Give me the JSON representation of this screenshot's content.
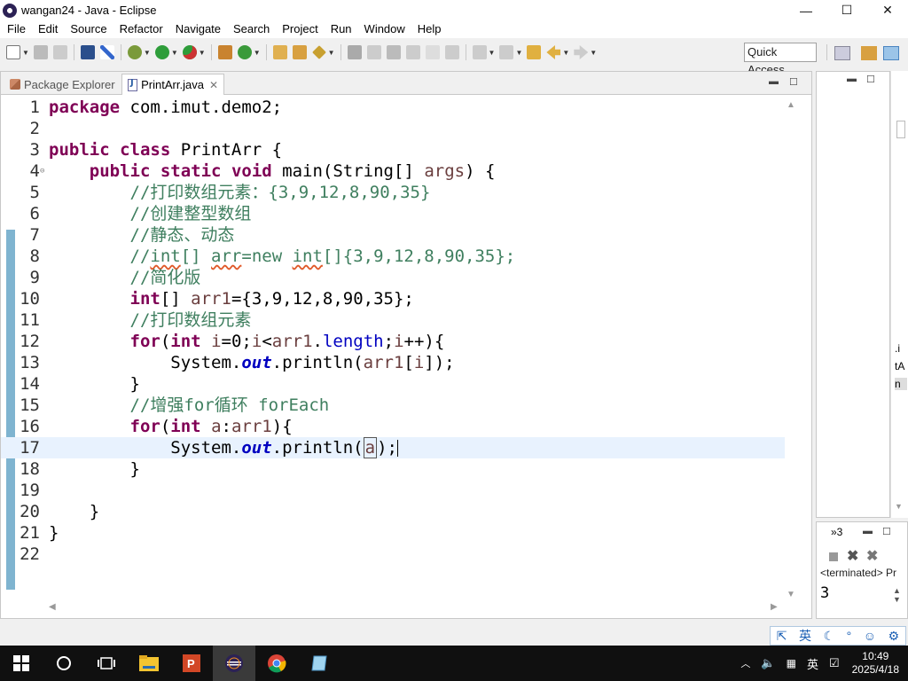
{
  "window": {
    "title": "wangan24 - Java - Eclipse",
    "controls": [
      "—",
      "☐",
      "✕"
    ]
  },
  "menu": [
    "File",
    "Edit",
    "Source",
    "Refactor",
    "Navigate",
    "Search",
    "Project",
    "Run",
    "Window",
    "Help"
  ],
  "toolbar": {
    "quick_access": "Quick Access"
  },
  "tabs": [
    {
      "label": "Package Explorer",
      "active": false
    },
    {
      "label": "PrintArr.java",
      "active": true,
      "close": "✕"
    }
  ],
  "editor": {
    "current_line": 17,
    "lines": [
      {
        "n": "1",
        "text": "package com.imut.demo2;"
      },
      {
        "n": "2",
        "text": ""
      },
      {
        "n": "3",
        "text": "public class PrintArr {"
      },
      {
        "n": "4",
        "text": "    public static void main(String[] args) {"
      },
      {
        "n": "5",
        "text": "        //打印数组元素：{3,9,12,8,90,35}"
      },
      {
        "n": "6",
        "text": "        //创建整型数组"
      },
      {
        "n": "7",
        "text": "        //静态、动态"
      },
      {
        "n": "8",
        "text": "        //int[] arr=new int[]{3,9,12,8,90,35};"
      },
      {
        "n": "9",
        "text": "        //简化版"
      },
      {
        "n": "10",
        "text": "        int[] arr1={3,9,12,8,90,35};"
      },
      {
        "n": "11",
        "text": "        //打印数组元素"
      },
      {
        "n": "12",
        "text": "        for(int i=0;i<arr1.length;i++){"
      },
      {
        "n": "13",
        "text": "            System.out.println(arr1[i]);"
      },
      {
        "n": "14",
        "text": "        }"
      },
      {
        "n": "15",
        "text": "        //增强for循环 forEach"
      },
      {
        "n": "16",
        "text": "        for(int a:arr1){"
      },
      {
        "n": "17",
        "text": "            System.out.println(a);"
      },
      {
        "n": "18",
        "text": "        }"
      },
      {
        "n": "19",
        "text": ""
      },
      {
        "n": "20",
        "text": "    }"
      },
      {
        "n": "21",
        "text": "}"
      },
      {
        "n": "22",
        "text": ""
      }
    ]
  },
  "console": {
    "tab_label": "»3",
    "status": "<terminated> Pr",
    "output": "3"
  },
  "side_strip": {
    "fragments": [
      ".i",
      "tA",
      "n"
    ]
  },
  "ime": [
    "英"
  ],
  "taskbar": {
    "tray_lang": "英",
    "time": "10:49",
    "date": "2025/4/18"
  },
  "colors": {
    "keyword": "#7f0055",
    "comment": "#3f7f5f",
    "static_field": "#0000c0",
    "current_line": "#e8f2fe",
    "taskbar": "#101010"
  }
}
